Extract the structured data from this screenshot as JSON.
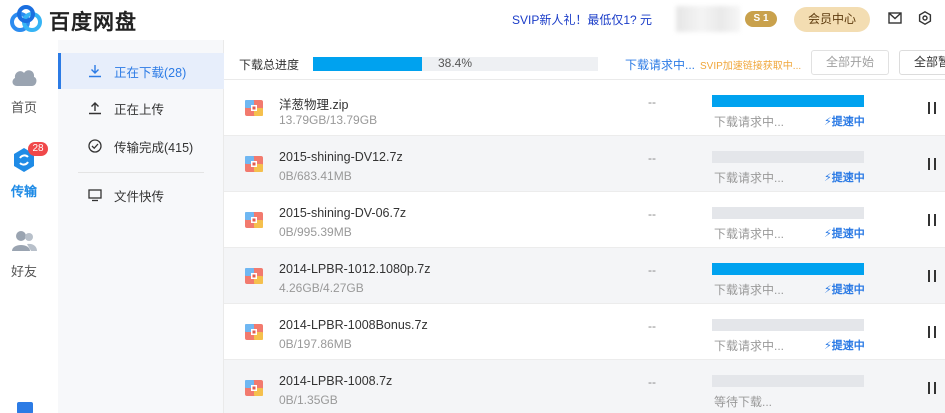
{
  "app": {
    "title": "百度网盘"
  },
  "topbar": {
    "promo": "SVIP新人礼！最低仅1? 元",
    "svip_level": "1",
    "member_center": "会员中心"
  },
  "rail": {
    "home": "首页",
    "transfer": "传输",
    "transfer_badge": "28",
    "friends": "好友"
  },
  "sidebar": {
    "items": [
      {
        "label": "正在下载(28)",
        "icon": "download-icon",
        "active": true
      },
      {
        "label": "正在上传",
        "icon": "upload-icon",
        "active": false
      },
      {
        "label": "传输完成(415)",
        "icon": "check-circle-icon",
        "active": false
      },
      {
        "label": "文件快传",
        "icon": "monitor-icon",
        "active": false
      }
    ]
  },
  "overall": {
    "label": "下载总进度",
    "percent_text": "38.4%",
    "percent": 38.4,
    "status": "下载请求中...",
    "svip_hint": "SVIP加速链接获取中...",
    "start_all": "全部开始",
    "pause_all": "全部暂停"
  },
  "downloads": [
    {
      "name": "洋葱物理.zip",
      "size": "13.79GB/13.79GB",
      "speed": "--",
      "progress": 100,
      "status": "下载请求中...",
      "accel": "提速中"
    },
    {
      "name": "2015-shining-DV12.7z",
      "size": "0B/683.41MB",
      "speed": "--",
      "progress": 0,
      "status": "下载请求中...",
      "accel": "提速中"
    },
    {
      "name": "2015-shining-DV-06.7z",
      "size": "0B/995.39MB",
      "speed": "--",
      "progress": 0,
      "status": "下载请求中...",
      "accel": "提速中"
    },
    {
      "name": "2014-LPBR-1012.1080p.7z",
      "size": "4.26GB/4.27GB",
      "speed": "--",
      "progress": 99.8,
      "status": "下载请求中...",
      "accel": "提速中"
    },
    {
      "name": "2014-LPBR-1008Bonus.7z",
      "size": "0B/197.86MB",
      "speed": "--",
      "progress": 0,
      "status": "下载请求中...",
      "accel": "提速中"
    },
    {
      "name": "2014-LPBR-1008.7z",
      "size": "0B/1.35GB",
      "speed": "--",
      "progress": 0,
      "status": "等待下载...",
      "accel": ""
    }
  ],
  "colors": {
    "accent": "#2c7be5",
    "progress": "#00a2ef",
    "badge": "#f0484a",
    "member": "#f3ddb2"
  }
}
